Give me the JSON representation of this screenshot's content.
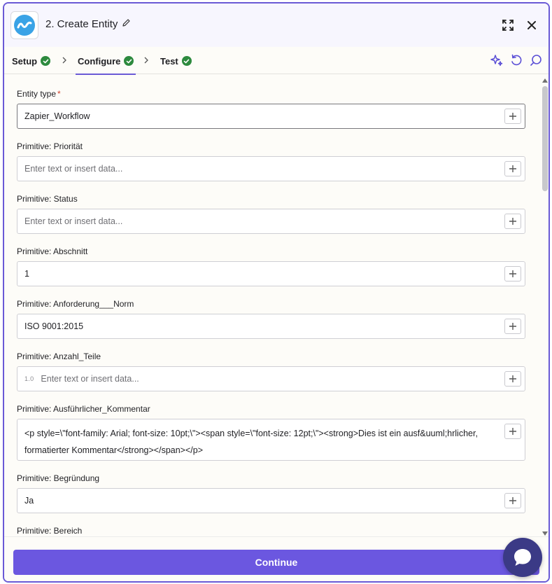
{
  "header": {
    "title": "2. Create Entity",
    "app_icon": "app-logo-icon",
    "edit_icon": "pencil-icon",
    "expand_icon": "expand-icon",
    "close_icon": "close-icon"
  },
  "tabs": [
    {
      "label": "Setup",
      "status": "complete",
      "active": false
    },
    {
      "label": "Configure",
      "status": "complete",
      "active": true
    },
    {
      "label": "Test",
      "status": "complete",
      "active": false
    }
  ],
  "toolbar": {
    "ai_icon": "sparkle-icon",
    "undo_icon": "undo-icon",
    "search_icon": "search-icon"
  },
  "fields": [
    {
      "label": "Entity type",
      "required": true,
      "value": "Zapier_Workflow",
      "placeholder": ""
    },
    {
      "label": "Primitive: Priorität",
      "value": "",
      "placeholder": "Enter text or insert data..."
    },
    {
      "label": "Primitive: Status",
      "value": "",
      "placeholder": "Enter text or insert data..."
    },
    {
      "label": "Primitive: Abschnitt",
      "value": "1",
      "placeholder": ""
    },
    {
      "label": "Primitive: Anforderung___Norm",
      "value": "ISO 9001:2015",
      "placeholder": ""
    },
    {
      "label": "Primitive: Anzahl_Teile",
      "value": "",
      "placeholder": "Enter text or insert data...",
      "type_badge": "1.0"
    },
    {
      "label": "Primitive: Ausführlicher_Kommentar",
      "value": "<p style=\\\"font-family: Arial; font-size: 10pt;\\\"><span style=\\\"font-size: 12pt;\\\"><strong>Dies ist ein ausf&uuml;hrlicher, formatierter Kommentar</strong></span></p>",
      "placeholder": ""
    },
    {
      "label": "Primitive: Begründung",
      "value": "Ja",
      "placeholder": ""
    },
    {
      "label": "Primitive: Bereich",
      "value": "",
      "placeholder": ""
    }
  ],
  "footer": {
    "continue_label": "Continue",
    "chat_icon": "chat-bubble-icon"
  },
  "colors": {
    "accent": "#6b57e0",
    "success": "#2d8a3e",
    "required": "#d0432e",
    "chat": "#3b3a86"
  }
}
